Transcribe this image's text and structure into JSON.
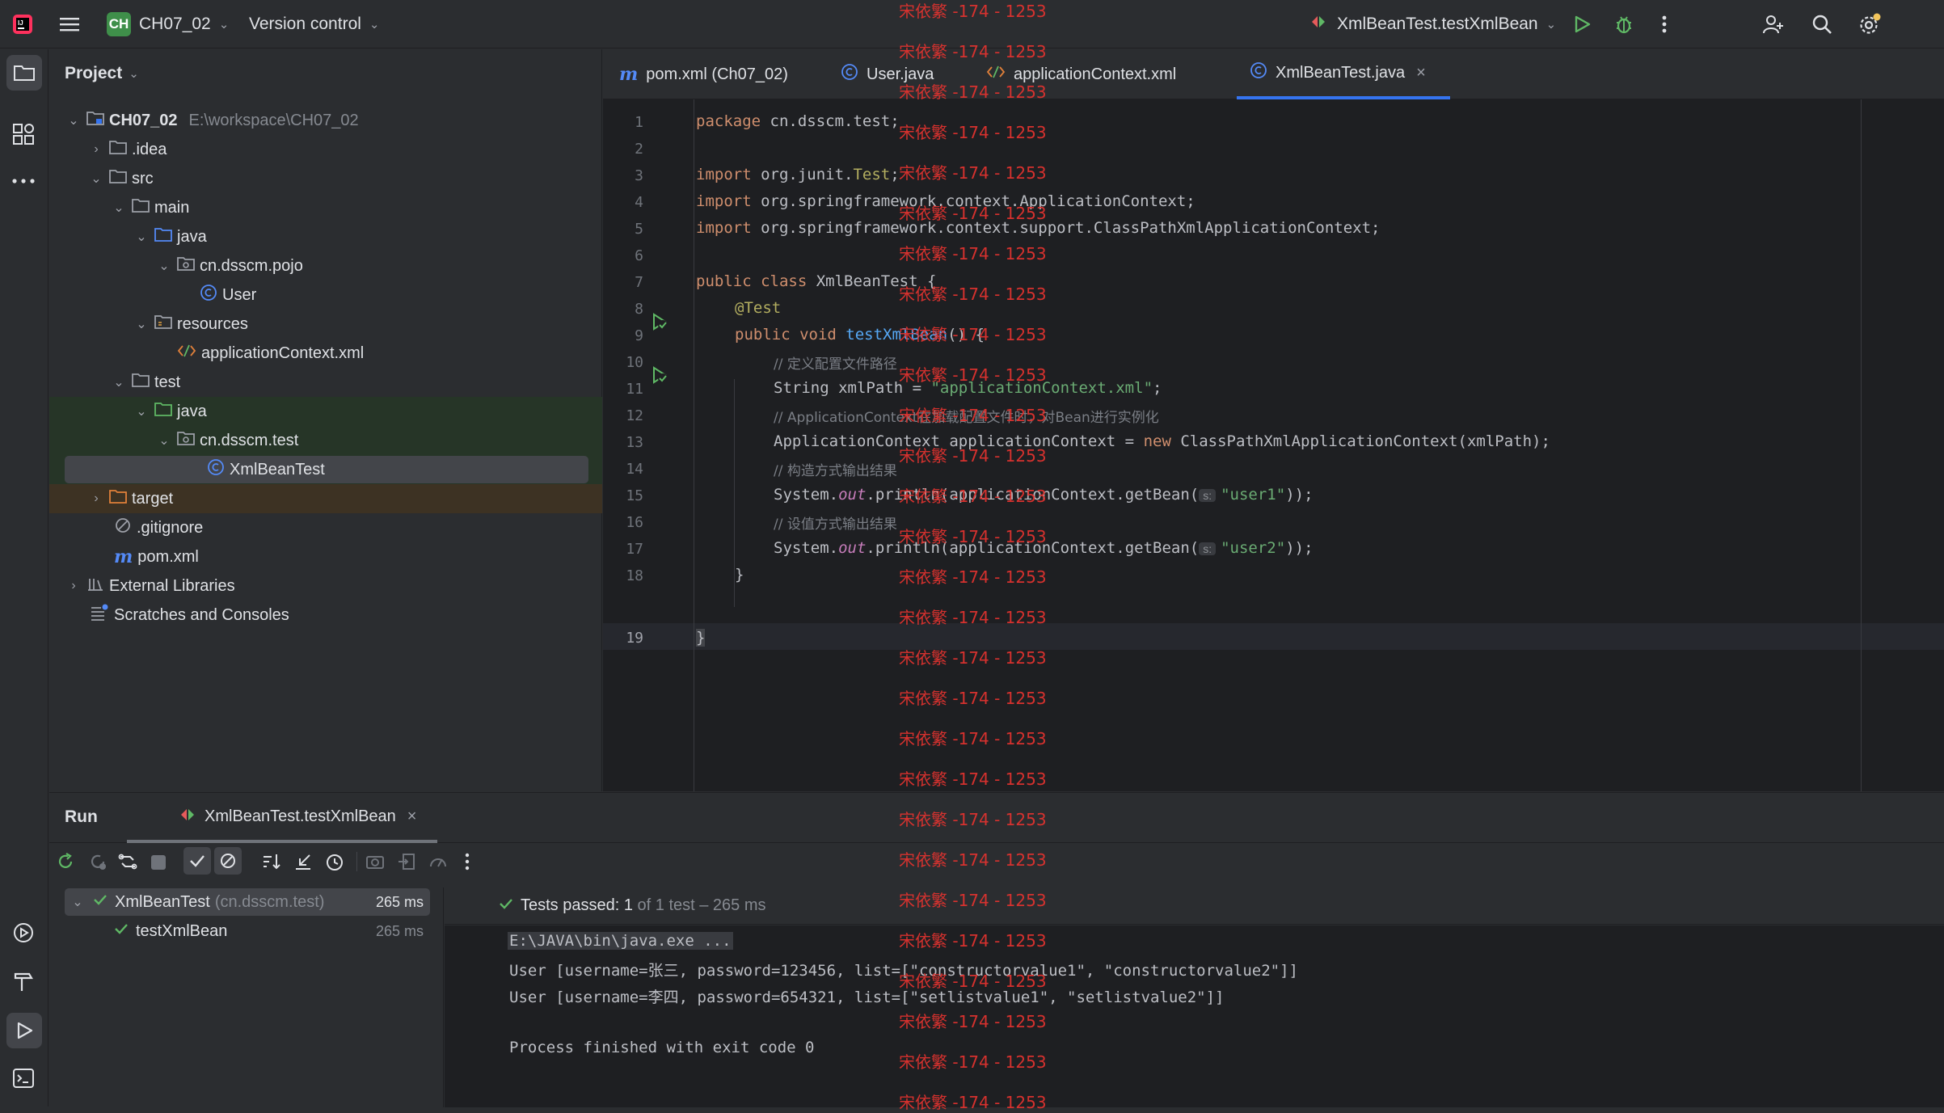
{
  "titlebar": {
    "project_badge": "CH",
    "project_name": "CH07_02",
    "vcs_label": "Version control",
    "run_config": "XmlBeanTest.testXmlBean"
  },
  "project_panel": {
    "title": "Project",
    "tree": [
      {
        "label": "CH07_02",
        "hint": "E:\\workspace\\CH07_02"
      },
      {
        "label": ".idea"
      },
      {
        "label": "src"
      },
      {
        "label": "main"
      },
      {
        "label": "java"
      },
      {
        "label": "cn.dsscm.pojo"
      },
      {
        "label": "User"
      },
      {
        "label": "resources"
      },
      {
        "label": "applicationContext.xml"
      },
      {
        "label": "test"
      },
      {
        "label": "java"
      },
      {
        "label": "cn.dsscm.test"
      },
      {
        "label": "XmlBeanTest"
      },
      {
        "label": "target"
      },
      {
        "label": ".gitignore"
      },
      {
        "label": "pom.xml"
      },
      {
        "label": "External Libraries"
      },
      {
        "label": "Scratches and Consoles"
      }
    ]
  },
  "editor": {
    "tabs": [
      {
        "label": "pom.xml (Ch07_02)"
      },
      {
        "label": "User.java"
      },
      {
        "label": "applicationContext.xml"
      },
      {
        "label": "XmlBeanTest.java"
      }
    ],
    "line_numbers": [
      "1",
      "2",
      "3",
      "4",
      "5",
      "6",
      "7",
      "8",
      "9",
      "10",
      "11",
      "12",
      "13",
      "14",
      "15",
      "16",
      "17",
      "18",
      "19"
    ],
    "code": {
      "l1_kw": "package",
      "l1_rest": " cn.dsscm.test;",
      "l3_kw": "import",
      "l3_a": " org.junit.",
      "l3_b": "Test",
      "l3_c": ";",
      "l4_kw": "import",
      "l4_rest": " org.springframework.context.ApplicationContext;",
      "l5_kw": "import",
      "l5_rest": " org.springframework.context.support.ClassPathXmlApplicationContext;",
      "l7_kw": "public class",
      "l7_rest": " XmlBeanTest {",
      "l8_an": "@Test",
      "l9_kw": "public void",
      "l9_fn": " testXmlBean",
      "l9_rest": "() {",
      "l10_cm": "// 定义配置文件路径",
      "l11_a": "String xmlPath = ",
      "l11_str": "\"applicationContext.xml\"",
      "l11_b": ";",
      "l12_cm": "// ApplicationContext在加载配置文件时，对Bean进行实例化",
      "l13_a": "ApplicationContext applicationContext = ",
      "l13_kw": "new",
      "l13_b": " ClassPathXmlApplicationContext(xmlPath);",
      "l14_cm": "// 构造方式输出结果",
      "l15_a": "System.",
      "l15_st": "out",
      "l15_b": ".println(applicationContext.getBean(",
      "l15_hint": "s:",
      "l15_str": "\"user1\"",
      "l15_c": "));",
      "l16_cm": "// 设值方式输出结果",
      "l17_a": "System.",
      "l17_st": "out",
      "l17_b": ".println(applicationContext.getBean(",
      "l17_hint": "s:",
      "l17_str": "\"user2\"",
      "l17_c": "));",
      "l18": "}",
      "l19": "}"
    }
  },
  "run_panel": {
    "title": "Run",
    "tab_label": "XmlBeanTest.testXmlBean",
    "test_class": "XmlBeanTest",
    "test_class_pkg": "(cn.dsscm.test)",
    "test_class_time": "265 ms",
    "test_method": "testXmlBean",
    "test_method_time": "265 ms",
    "status_prefix": "Tests passed: ",
    "status_count": "1",
    "status_suffix": " of 1 test – 265 ms",
    "console": [
      "E:\\JAVA\\bin\\java.exe ...",
      "User [username=张三, password=123456, list=[\"constructorvalue1\", \"constructorvalue2\"]]",
      "User [username=李四, password=654321, list=[\"setlistvalue1\", \"setlistvalue2\"]]",
      "",
      "Process finished with exit code 0"
    ]
  },
  "watermark": "宋依繁 -174 - 1253",
  "colors": {
    "accent": "#3574f0",
    "success": "#5fb865",
    "watermark": "#e0332f"
  }
}
